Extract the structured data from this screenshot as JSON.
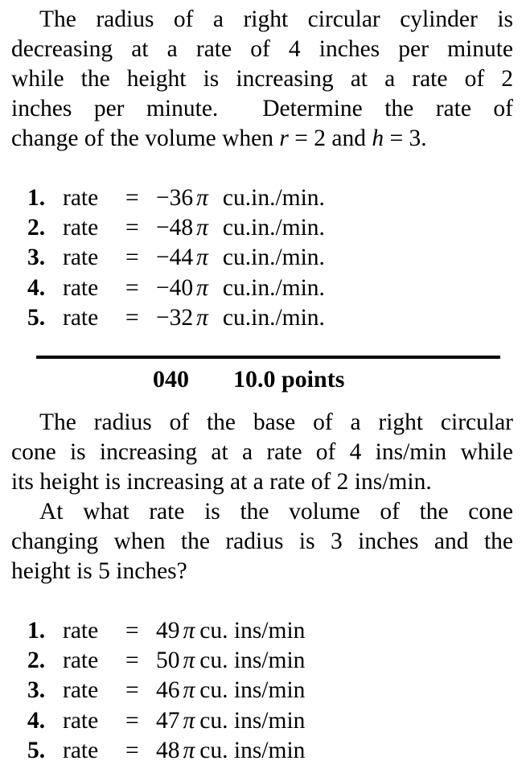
{
  "problem_a": {
    "lines": [
      "The radius of a right circular cylinder is",
      "decreasing at a rate of 4 inches per minute",
      "while the height is increasing at a rate of 2",
      "inches per minute.  Determine the rate of"
    ],
    "last_line_prefix": "change of the volume when ",
    "var_r": "r",
    "eq_r": " = 2 and ",
    "var_h": "h",
    "eq_h": " = 3.",
    "choices": [
      {
        "num": "1.",
        "word": "rate",
        "eq": "=",
        "value": "−36",
        "pi": "π",
        "unit": "cu.in./min."
      },
      {
        "num": "2.",
        "word": "rate",
        "eq": "=",
        "value": "−48",
        "pi": "π",
        "unit": "cu.in./min."
      },
      {
        "num": "3.",
        "word": "rate",
        "eq": "=",
        "value": "−44",
        "pi": "π",
        "unit": "cu.in./min."
      },
      {
        "num": "4.",
        "word": "rate",
        "eq": "=",
        "value": "−40",
        "pi": "π",
        "unit": "cu.in./min."
      },
      {
        "num": "5.",
        "word": "rate",
        "eq": "=",
        "value": "−32",
        "pi": "π",
        "unit": "cu.in./min."
      }
    ]
  },
  "problem_b": {
    "number": "040",
    "points": "10.0 points",
    "lines": [
      "The radius of the base of a right circular",
      "cone is increasing at a rate of 4 ins/min while",
      "its height is increasing at a rate of 2 ins/min.",
      "At what rate is the volume of the cone",
      "changing when the radius is 3 inches and the",
      "height is 5 inches?"
    ],
    "choices": [
      {
        "num": "1.",
        "word": "rate",
        "eq": "=",
        "value": "49",
        "pi": "π",
        "unit": "cu. ins/min"
      },
      {
        "num": "2.",
        "word": "rate",
        "eq": "=",
        "value": "50",
        "pi": "π",
        "unit": "cu. ins/min"
      },
      {
        "num": "3.",
        "word": "rate",
        "eq": "=",
        "value": "46",
        "pi": "π",
        "unit": "cu. ins/min"
      },
      {
        "num": "4.",
        "word": "rate",
        "eq": "=",
        "value": "47",
        "pi": "π",
        "unit": "cu. ins/min"
      },
      {
        "num": "5.",
        "word": "rate",
        "eq": "=",
        "value": "48",
        "pi": "π",
        "unit": "cu. ins/min"
      }
    ]
  }
}
